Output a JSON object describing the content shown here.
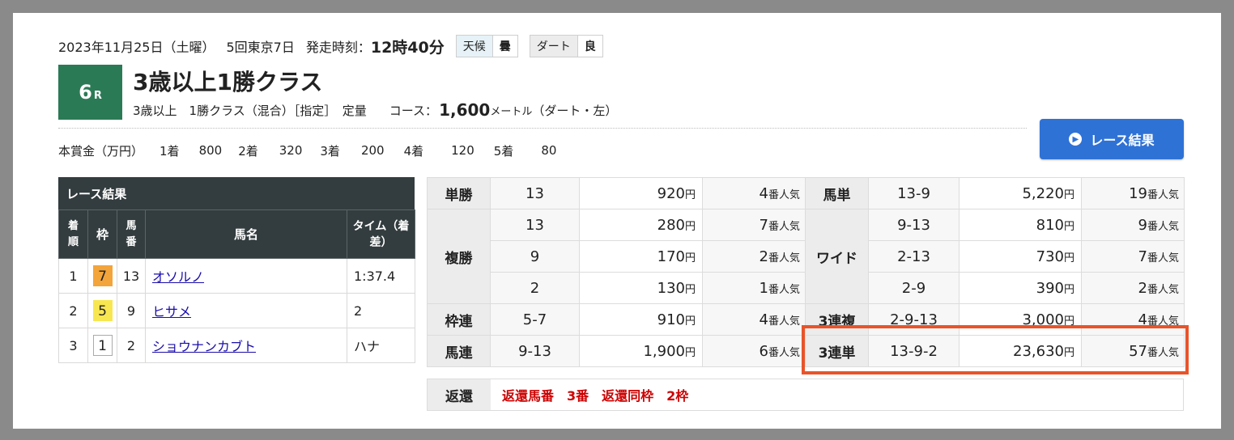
{
  "race_meta": {
    "date": "2023年11月25日（土曜）",
    "meeting": "5回東京7日",
    "post_time_label": "発走時刻：",
    "post_time": "12時40分",
    "weather_label": "天候",
    "weather": "曇",
    "track_label": "ダート",
    "track_condition": "良"
  },
  "race": {
    "number": "6",
    "suffix": "R",
    "title": "3歳以上1勝クラス",
    "conditions": "3歳以上　1勝クラス（混合）［指定］　定量",
    "course_label": "コース：",
    "distance": "1,600",
    "distance_unit": "メートル",
    "course_note": "（ダート・左）"
  },
  "prize": {
    "label": "本賞金（万円）",
    "places": [
      {
        "place": "1着",
        "amount": "800"
      },
      {
        "place": "2着",
        "amount": "320"
      },
      {
        "place": "3着",
        "amount": "200"
      },
      {
        "place": "4着",
        "amount": "120"
      },
      {
        "place": "5着",
        "amount": "80"
      }
    ]
  },
  "result_button": "レース結果",
  "results": {
    "title": "レース結果",
    "headers": [
      "着順",
      "枠",
      "馬番",
      "馬名",
      "タイム（着差）"
    ],
    "rows": [
      {
        "pos": "1",
        "waku": "7",
        "num": "13",
        "name": "オソルノ",
        "time": "1:37.4"
      },
      {
        "pos": "2",
        "waku": "5",
        "num": "9",
        "name": "ヒサメ",
        "time": "2"
      },
      {
        "pos": "3",
        "waku": "1",
        "num": "2",
        "name": "ショウナンカブト",
        "time": "ハナ"
      }
    ]
  },
  "colors": {
    "waku_7": "#f3a43a",
    "waku_5": "#f7e650",
    "waku_1": "#ffffff",
    "race_box": "#2b7a56",
    "button": "#2f72d6",
    "highlight": "#e8542a",
    "refund_text": "#cc0000"
  },
  "payouts": {
    "yen": "円",
    "pop_suffix": "番人気",
    "tansho": {
      "label": "単勝",
      "num": "13",
      "amount": "920",
      "pop": "4"
    },
    "fukusho": {
      "label": "複勝",
      "rows": [
        {
          "num": "13",
          "amount": "280",
          "pop": "7"
        },
        {
          "num": "9",
          "amount": "170",
          "pop": "2"
        },
        {
          "num": "2",
          "amount": "130",
          "pop": "1"
        }
      ]
    },
    "wakuren": {
      "label": "枠連",
      "num": "5-7",
      "amount": "910",
      "pop": "4"
    },
    "umaren": {
      "label": "馬連",
      "num": "9-13",
      "amount": "1,900",
      "pop": "6"
    },
    "umatan": {
      "label": "馬単",
      "num": "13-9",
      "amount": "5,220",
      "pop": "19"
    },
    "wide": {
      "label": "ワイド",
      "rows": [
        {
          "num": "9-13",
          "amount": "810",
          "pop": "9"
        },
        {
          "num": "2-13",
          "amount": "730",
          "pop": "7"
        },
        {
          "num": "2-9",
          "amount": "390",
          "pop": "2"
        }
      ]
    },
    "sanrenpuku": {
      "label": "3連複",
      "num": "2-9-13",
      "amount": "3,000",
      "pop": "4"
    },
    "sanrentan": {
      "label": "3連単",
      "num": "13-9-2",
      "amount": "23,630",
      "pop": "57"
    }
  },
  "refund": {
    "label": "返還",
    "value": "返還馬番　3番　返還同枠　2枠"
  }
}
